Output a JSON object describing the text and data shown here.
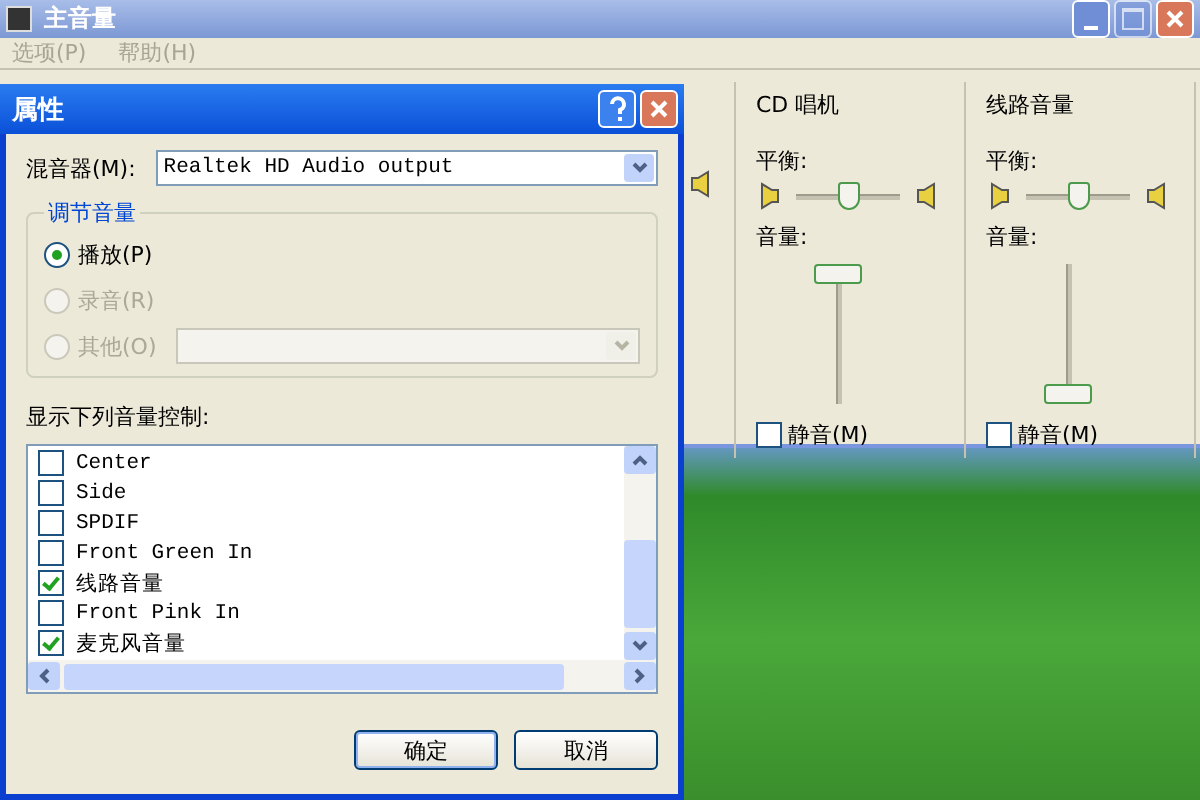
{
  "main_window": {
    "title": "主音量",
    "menu": [
      "选项(P)",
      "帮助(H)"
    ],
    "channels": [
      {
        "name": "CD 唱机",
        "balance_label": "平衡:",
        "balance": {
          "level": 0.5
        },
        "volume_label": "音量:",
        "volume": {
          "level": 1
        },
        "mute": {
          "label": "静音(M)",
          "checked": false
        }
      },
      {
        "name": "线路音量",
        "balance_label": "平衡:",
        "balance": {
          "level": 0.5
        },
        "volume_label": "音量:",
        "volume": {
          "level": 0
        },
        "mute": {
          "label": "静音(M)",
          "checked": false
        }
      }
    ]
  },
  "dialog": {
    "title": "属性",
    "mixer_label": "混音器(M):",
    "mixer_value": "Realtek HD Audio output",
    "group_title": "调节音量",
    "radios": [
      {
        "label": "播放(P)",
        "selected": true,
        "disabled": false
      },
      {
        "label": "录音(R)",
        "selected": false,
        "disabled": true
      },
      {
        "label": "其他(O)",
        "selected": false,
        "disabled": true
      }
    ],
    "list_label": "显示下列音量控制:",
    "items": [
      {
        "label": "Center",
        "checked": false
      },
      {
        "label": "Side",
        "checked": false
      },
      {
        "label": "SPDIF",
        "checked": false
      },
      {
        "label": "Front Green In",
        "checked": false
      },
      {
        "label": "线路音量",
        "checked": true
      },
      {
        "label": "Front Pink In",
        "checked": false
      },
      {
        "label": "麦克风音量",
        "checked": true
      }
    ],
    "buttons": [
      "确定",
      "取消"
    ]
  }
}
